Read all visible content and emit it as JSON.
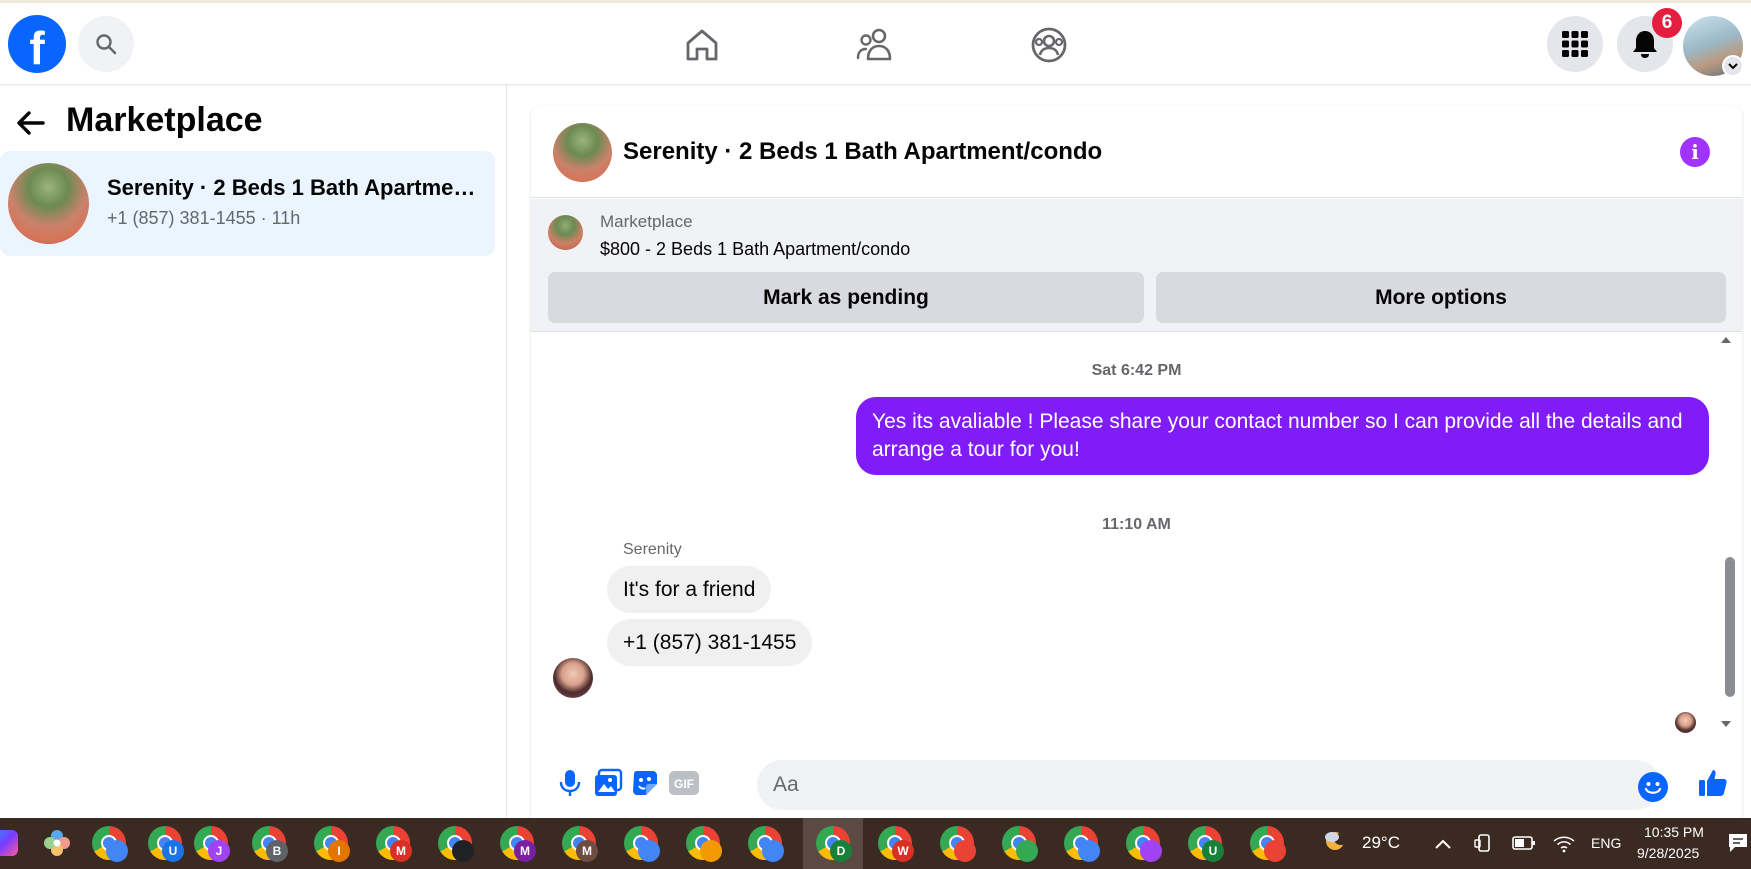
{
  "topbar": {
    "logo_letter": "f",
    "notifications_count": "6"
  },
  "left": {
    "title": "Marketplace",
    "conversation": {
      "title": "Serenity · 2 Beds 1 Bath Apartment/condo",
      "subtitle": "+1 (857) 381-1455 · 11h"
    }
  },
  "chat": {
    "header_title": "Serenity · 2 Beds 1 Bath Apartment/condo",
    "info_glyph": "i",
    "listing": {
      "label": "Marketplace",
      "price_line": "$800 - 2 Beds 1 Bath Apartment/condo",
      "mark_pending_label": "Mark as pending",
      "more_options_label": "More options"
    },
    "messages": {
      "timestamp_1": "Sat 6:42 PM",
      "outgoing_1": "Yes its avaliable ! Please share your contact number so I can provide all the details and arrange a tour for you!",
      "timestamp_2": "11:10 AM",
      "sender_name": "Serenity",
      "incoming_1": "It's for a friend",
      "incoming_2": "+1 (857) 381-1455"
    },
    "composer": {
      "placeholder": "Aa",
      "gif_label": "GIF"
    }
  },
  "taskbar": {
    "apps": [
      {
        "letter": "",
        "sub_color": "#4285f4"
      },
      {
        "letter": "U",
        "sub_color": "#1a73e8"
      },
      {
        "letter": "J",
        "sub_color": "#a142f4"
      },
      {
        "letter": "B",
        "sub_color": "#5f6368"
      },
      {
        "letter": "I",
        "sub_color": "#e37400"
      },
      {
        "letter": "M",
        "sub_color": "#d93025"
      },
      {
        "letter": "",
        "sub_color": "#202124"
      },
      {
        "letter": "M",
        "sub_color": "#7b1fa2"
      },
      {
        "letter": "M",
        "sub_color": "#6d4c41"
      },
      {
        "letter": "",
        "sub_color": "#4285f4"
      },
      {
        "letter": "",
        "sub_color": "#f29900"
      },
      {
        "letter": "",
        "sub_color": "#4285f4"
      },
      {
        "letter": "D",
        "sub_color": "#188038"
      },
      {
        "letter": "W",
        "sub_color": "#d93025"
      },
      {
        "letter": "",
        "sub_color": "#ea4335"
      },
      {
        "letter": "",
        "sub_color": "#34a853"
      },
      {
        "letter": "",
        "sub_color": "#4285f4"
      },
      {
        "letter": "",
        "sub_color": "#a142f4"
      },
      {
        "letter": "U",
        "sub_color": "#188038"
      },
      {
        "letter": "",
        "sub_color": "#ea4335"
      }
    ],
    "temperature": "29°C",
    "language": "ENG",
    "time": "10:35 PM",
    "date": "9/28/2025"
  },
  "colors": {
    "brand_blue": "#0866ff",
    "accent_purple": "#7f1cf8",
    "badge_red": "#e41e3f",
    "taskbar_bg": "#3a2a22"
  }
}
